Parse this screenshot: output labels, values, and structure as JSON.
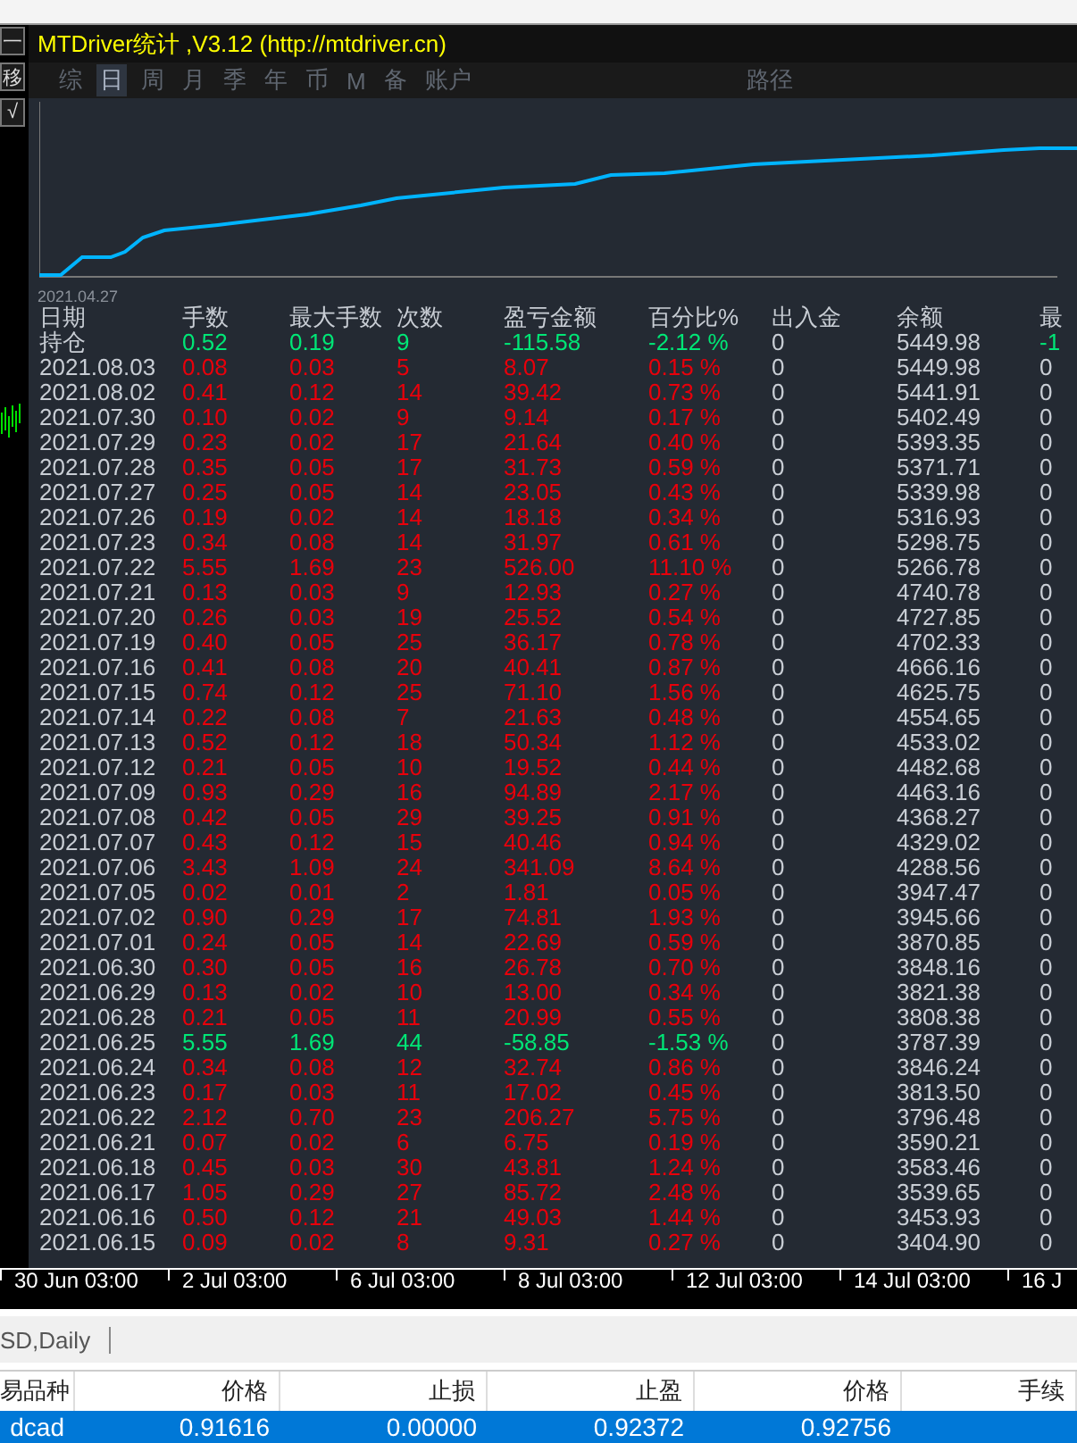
{
  "side_buttons": [
    "一",
    "移",
    "√"
  ],
  "window": {
    "title": "MTDriver统计 ,V3.12 (http://mtdriver.cn)"
  },
  "tabs": [
    {
      "label": "综",
      "selected": false
    },
    {
      "label": "日",
      "selected": true
    },
    {
      "label": "周",
      "selected": false
    },
    {
      "label": "月",
      "selected": false
    },
    {
      "label": "季",
      "selected": false
    },
    {
      "label": "年",
      "selected": false
    },
    {
      "label": "币",
      "selected": false
    },
    {
      "label": "M",
      "selected": false
    },
    {
      "label": "备",
      "selected": false
    },
    {
      "label": "账户",
      "selected": false
    },
    {
      "label": "路径",
      "selected": false
    }
  ],
  "chart": {
    "start_label": "2021.04.27"
  },
  "table": {
    "columns": [
      "日期",
      "手数",
      "最大手数",
      "次数",
      "盈亏金额",
      "百分比%",
      "出入金",
      "余额",
      "最"
    ],
    "rows": [
      {
        "kind": "loss",
        "cells": [
          "持仓",
          "0.52",
          "0.19",
          "9",
          "-115.58",
          "-2.12 %",
          "0",
          "5449.98",
          "-1"
        ]
      },
      {
        "kind": "profit",
        "cells": [
          "2021.08.03",
          "0.08",
          "0.03",
          "5",
          "8.07",
          "0.15 %",
          "0",
          "5449.98",
          "0"
        ]
      },
      {
        "kind": "profit",
        "cells": [
          "2021.08.02",
          "0.41",
          "0.12",
          "14",
          "39.42",
          "0.73 %",
          "0",
          "5441.91",
          "0"
        ]
      },
      {
        "kind": "profit",
        "cells": [
          "2021.07.30",
          "0.10",
          "0.02",
          "9",
          "9.14",
          "0.17 %",
          "0",
          "5402.49",
          "0"
        ]
      },
      {
        "kind": "profit",
        "cells": [
          "2021.07.29",
          "0.23",
          "0.02",
          "17",
          "21.64",
          "0.40 %",
          "0",
          "5393.35",
          "0"
        ]
      },
      {
        "kind": "profit",
        "cells": [
          "2021.07.28",
          "0.35",
          "0.05",
          "17",
          "31.73",
          "0.59 %",
          "0",
          "5371.71",
          "0"
        ]
      },
      {
        "kind": "profit",
        "cells": [
          "2021.07.27",
          "0.25",
          "0.05",
          "14",
          "23.05",
          "0.43 %",
          "0",
          "5339.98",
          "0"
        ]
      },
      {
        "kind": "profit",
        "cells": [
          "2021.07.26",
          "0.19",
          "0.02",
          "14",
          "18.18",
          "0.34 %",
          "0",
          "5316.93",
          "0"
        ]
      },
      {
        "kind": "profit",
        "cells": [
          "2021.07.23",
          "0.34",
          "0.08",
          "14",
          "31.97",
          "0.61 %",
          "0",
          "5298.75",
          "0"
        ]
      },
      {
        "kind": "profit",
        "cells": [
          "2021.07.22",
          "5.55",
          "1.69",
          "23",
          "526.00",
          "11.10 %",
          "0",
          "5266.78",
          "0"
        ]
      },
      {
        "kind": "profit",
        "cells": [
          "2021.07.21",
          "0.13",
          "0.03",
          "9",
          "12.93",
          "0.27 %",
          "0",
          "4740.78",
          "0"
        ]
      },
      {
        "kind": "profit",
        "cells": [
          "2021.07.20",
          "0.26",
          "0.03",
          "19",
          "25.52",
          "0.54 %",
          "0",
          "4727.85",
          "0"
        ]
      },
      {
        "kind": "profit",
        "cells": [
          "2021.07.19",
          "0.40",
          "0.05",
          "25",
          "36.17",
          "0.78 %",
          "0",
          "4702.33",
          "0"
        ]
      },
      {
        "kind": "profit",
        "cells": [
          "2021.07.16",
          "0.41",
          "0.08",
          "20",
          "40.41",
          "0.87 %",
          "0",
          "4666.16",
          "0"
        ]
      },
      {
        "kind": "profit",
        "cells": [
          "2021.07.15",
          "0.74",
          "0.12",
          "25",
          "71.10",
          "1.56 %",
          "0",
          "4625.75",
          "0"
        ]
      },
      {
        "kind": "profit",
        "cells": [
          "2021.07.14",
          "0.22",
          "0.08",
          "7",
          "21.63",
          "0.48 %",
          "0",
          "4554.65",
          "0"
        ]
      },
      {
        "kind": "profit",
        "cells": [
          "2021.07.13",
          "0.52",
          "0.12",
          "18",
          "50.34",
          "1.12 %",
          "0",
          "4533.02",
          "0"
        ]
      },
      {
        "kind": "profit",
        "cells": [
          "2021.07.12",
          "0.21",
          "0.05",
          "10",
          "19.52",
          "0.44 %",
          "0",
          "4482.68",
          "0"
        ]
      },
      {
        "kind": "profit",
        "cells": [
          "2021.07.09",
          "0.93",
          "0.29",
          "16",
          "94.89",
          "2.17 %",
          "0",
          "4463.16",
          "0"
        ]
      },
      {
        "kind": "profit",
        "cells": [
          "2021.07.08",
          "0.42",
          "0.05",
          "29",
          "39.25",
          "0.91 %",
          "0",
          "4368.27",
          "0"
        ]
      },
      {
        "kind": "profit",
        "cells": [
          "2021.07.07",
          "0.43",
          "0.12",
          "15",
          "40.46",
          "0.94 %",
          "0",
          "4329.02",
          "0"
        ]
      },
      {
        "kind": "profit",
        "cells": [
          "2021.07.06",
          "3.43",
          "1.09",
          "24",
          "341.09",
          "8.64 %",
          "0",
          "4288.56",
          "0"
        ]
      },
      {
        "kind": "profit",
        "cells": [
          "2021.07.05",
          "0.02",
          "0.01",
          "2",
          "1.81",
          "0.05 %",
          "0",
          "3947.47",
          "0"
        ]
      },
      {
        "kind": "profit",
        "cells": [
          "2021.07.02",
          "0.90",
          "0.29",
          "17",
          "74.81",
          "1.93 %",
          "0",
          "3945.66",
          "0"
        ]
      },
      {
        "kind": "profit",
        "cells": [
          "2021.07.01",
          "0.24",
          "0.05",
          "14",
          "22.69",
          "0.59 %",
          "0",
          "3870.85",
          "0"
        ]
      },
      {
        "kind": "profit",
        "cells": [
          "2021.06.30",
          "0.30",
          "0.05",
          "16",
          "26.78",
          "0.70 %",
          "0",
          "3848.16",
          "0"
        ]
      },
      {
        "kind": "profit",
        "cells": [
          "2021.06.29",
          "0.13",
          "0.02",
          "10",
          "13.00",
          "0.34 %",
          "0",
          "3821.38",
          "0"
        ]
      },
      {
        "kind": "profit",
        "cells": [
          "2021.06.28",
          "0.21",
          "0.05",
          "11",
          "20.99",
          "0.55 %",
          "0",
          "3808.38",
          "0"
        ]
      },
      {
        "kind": "loss",
        "cells": [
          "2021.06.25",
          "5.55",
          "1.69",
          "44",
          "-58.85",
          "-1.53 %",
          "0",
          "3787.39",
          "0"
        ]
      },
      {
        "kind": "profit",
        "cells": [
          "2021.06.24",
          "0.34",
          "0.08",
          "12",
          "32.74",
          "0.86 %",
          "0",
          "3846.24",
          "0"
        ]
      },
      {
        "kind": "profit",
        "cells": [
          "2021.06.23",
          "0.17",
          "0.03",
          "11",
          "17.02",
          "0.45 %",
          "0",
          "3813.50",
          "0"
        ]
      },
      {
        "kind": "profit",
        "cells": [
          "2021.06.22",
          "2.12",
          "0.70",
          "23",
          "206.27",
          "5.75 %",
          "0",
          "3796.48",
          "0"
        ]
      },
      {
        "kind": "profit",
        "cells": [
          "2021.06.21",
          "0.07",
          "0.02",
          "6",
          "6.75",
          "0.19 %",
          "0",
          "3590.21",
          "0"
        ]
      },
      {
        "kind": "profit",
        "cells": [
          "2021.06.18",
          "0.45",
          "0.03",
          "30",
          "43.81",
          "1.24 %",
          "0",
          "3583.46",
          "0"
        ]
      },
      {
        "kind": "profit",
        "cells": [
          "2021.06.17",
          "1.05",
          "0.29",
          "27",
          "85.72",
          "2.48 %",
          "0",
          "3539.65",
          "0"
        ]
      },
      {
        "kind": "profit",
        "cells": [
          "2021.06.16",
          "0.50",
          "0.12",
          "21",
          "49.03",
          "1.44 %",
          "0",
          "3453.93",
          "0"
        ]
      },
      {
        "kind": "profit",
        "cells": [
          "2021.06.15",
          "0.09",
          "0.02",
          "8",
          "9.31",
          "0.27 %",
          "0",
          "3404.90",
          "0"
        ]
      }
    ]
  },
  "time_axis": [
    "30 Jun 03:00",
    "2 Jul 03:00",
    "6 Jul 03:00",
    "8 Jul 03:00",
    "12 Jul 03:00",
    "14 Jul 03:00",
    "16 J"
  ],
  "chart_tab": "SD,Daily",
  "orders": {
    "columns": [
      "易品种",
      "价格",
      "止损",
      "止盈",
      "价格",
      "手续"
    ],
    "rows": [
      {
        "selected": true,
        "cells": [
          "dcad",
          "0.91616",
          "0.00000",
          "0.92372",
          "0.92756"
        ]
      }
    ]
  }
}
